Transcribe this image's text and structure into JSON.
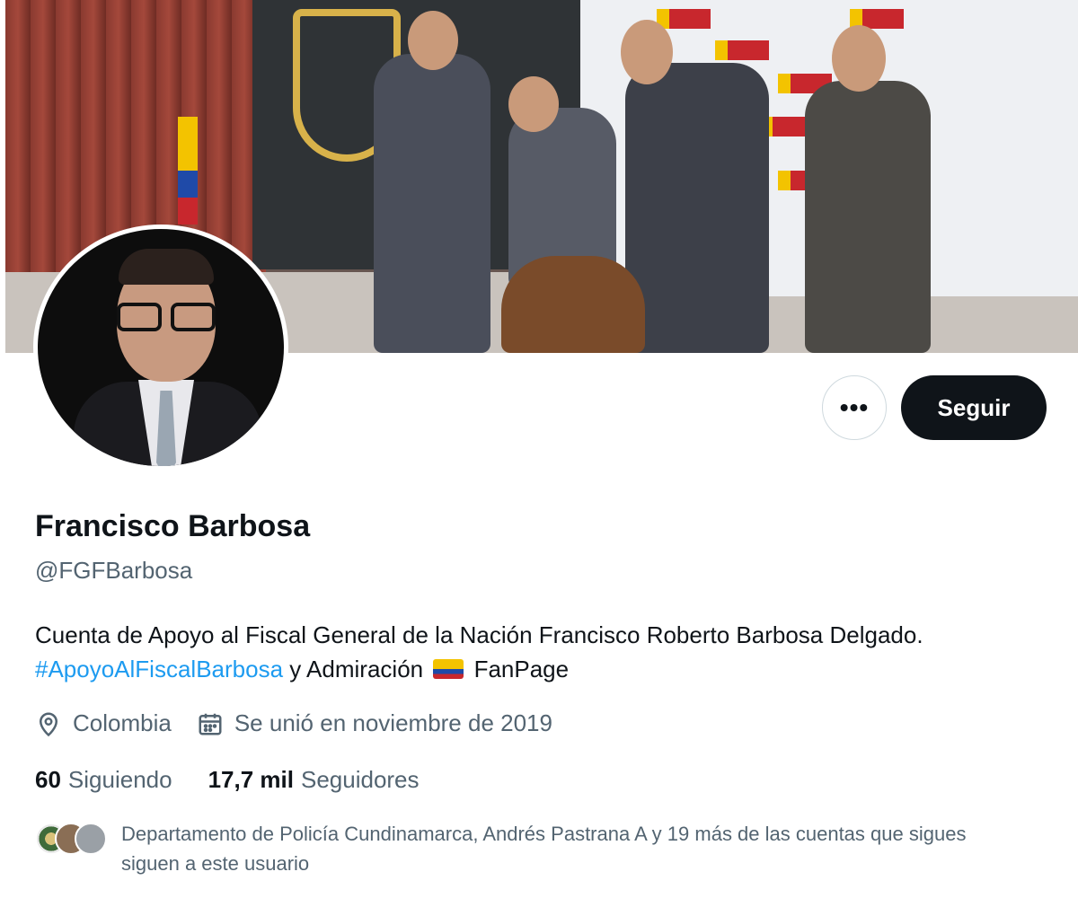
{
  "profile": {
    "name": "Francisco Barbosa",
    "handle": "@FGFBarbosa",
    "bio_text_1": "Cuenta de Apoyo al Fiscal General de la Nación Francisco Roberto Barbosa Delgado. ",
    "bio_hashtag": "#ApoyoAlFiscalBarbosa",
    "bio_text_2": " y Admiración ",
    "bio_text_3": " FanPage",
    "location": "Colombia",
    "joined": "Se unió en noviembre de 2019"
  },
  "stats": {
    "following_count": "60",
    "following_label": "Siguiendo",
    "followers_count": "17,7 mil",
    "followers_label": "Seguidores"
  },
  "actions": {
    "more_label": "•••",
    "follow_label": "Seguir"
  },
  "known_followers": {
    "text": "Departamento de Policía Cundinamarca, Andrés Pastrana A y 19 más de las cuentas que sigues siguen a este usuario"
  },
  "colors": {
    "link": "#1d9bf0",
    "secondary_text": "#536471",
    "primary_text": "#0f1419",
    "follow_button_bg": "#0f1419"
  },
  "icons": {
    "location": "location-pin-icon",
    "calendar": "calendar-icon",
    "flag": "colombia-flag-icon"
  }
}
